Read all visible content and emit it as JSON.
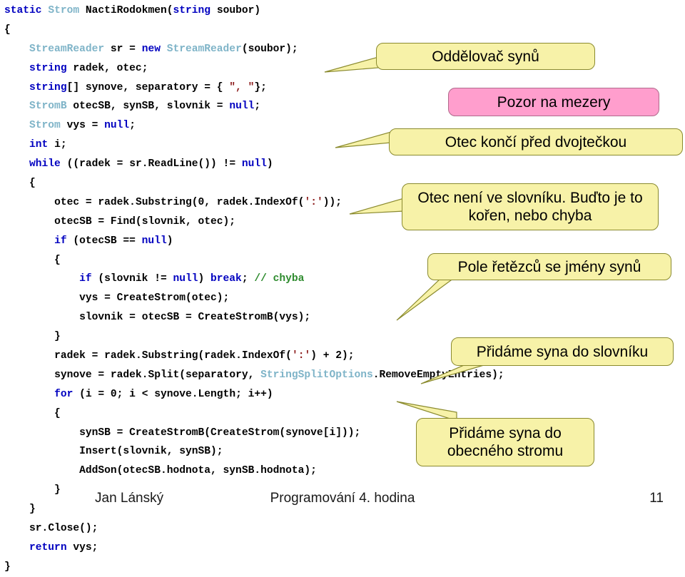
{
  "slide": {
    "footer": {
      "author": "Jan Lánský",
      "title": "Programování 4. hodina",
      "page_number": "11"
    }
  },
  "code": {
    "language": "csharp",
    "colors": {
      "keyword": "#0000C0",
      "type": "#7FB4C8",
      "string": "#8B1A1A",
      "comment": "#2E8B2E",
      "plain": "#000000"
    },
    "lines": [
      "static Strom NactiRodokmen(string soubor)",
      "{",
      "    StreamReader sr = new StreamReader(soubor);",
      "    string radek, otec;",
      "    string[] synove, separatory = { \", \"};",
      "    StromB otecSB, synSB, slovnik = null;",
      "    Strom vys = null;",
      "    int i;",
      "    while ((radek = sr.ReadLine()) != null)",
      "    {",
      "        otec = radek.Substring(0, radek.IndexOf(':'));",
      "        otecSB = Find(slovnik, otec);",
      "        if (otecSB == null)",
      "        {",
      "            if (slovnik != null) break; // chyba",
      "            vys = CreateStrom(otec);",
      "            slovnik = otecSB = CreateStromB(vys);",
      "        }",
      "        radek = radek.Substring(radek.IndexOf(':') + 2);",
      "        synove = radek.Split(separatory, StringSplitOptions.RemoveEmptyEntries);",
      "        for (i = 0; i < synove.Length; i++)",
      "        {",
      "            synSB = CreateStromB(CreateStrom(synove[i]));",
      "            Insert(slovnik, synSB);",
      "            AddSon(otecSB.hodnota, synSB.hodnota);",
      "        }",
      "    }",
      "    sr.Close();",
      "    return vys;",
      "}"
    ]
  },
  "callouts": [
    {
      "id": "separator",
      "text": "Oddělovač synů",
      "color": "#F7F2A8",
      "kind": "yellow",
      "points_to": "string[] synove, separatory line"
    },
    {
      "id": "spaces-warning",
      "text": "Pozor na mezery",
      "color": "#FF9ECD",
      "kind": "pink",
      "points_to": null
    },
    {
      "id": "father-before-colon",
      "text": "Otec končí před dvojtečkou",
      "color": "#F7F2A8",
      "kind": "yellow",
      "points_to": "while ((radek = sr.ReadLine()) != null)"
    },
    {
      "id": "father-not-in-dict",
      "text": "Otec není ve slovníku. Buďto je to kořen, nebo chyba",
      "color": "#F7F2A8",
      "kind": "yellow",
      "points_to": "if (otecSB == null)"
    },
    {
      "id": "string-array-of-sons",
      "text": "Pole řetězců se jmény synů",
      "color": "#F7F2A8",
      "kind": "yellow",
      "points_to": "synove = radek.Split(...)"
    },
    {
      "id": "add-son-to-dictionary",
      "text": "Přidáme syna do slovníku",
      "color": "#F7F2A8",
      "kind": "yellow",
      "points_to": "Insert(slovnik, synSB);"
    },
    {
      "id": "add-son-to-general-tree",
      "text": "Přidáme syna do obecného stromu",
      "color": "#F7F2A8",
      "kind": "yellow",
      "points_to": "AddSon(otecSB.hodnota, synSB.hodnota);"
    }
  ]
}
